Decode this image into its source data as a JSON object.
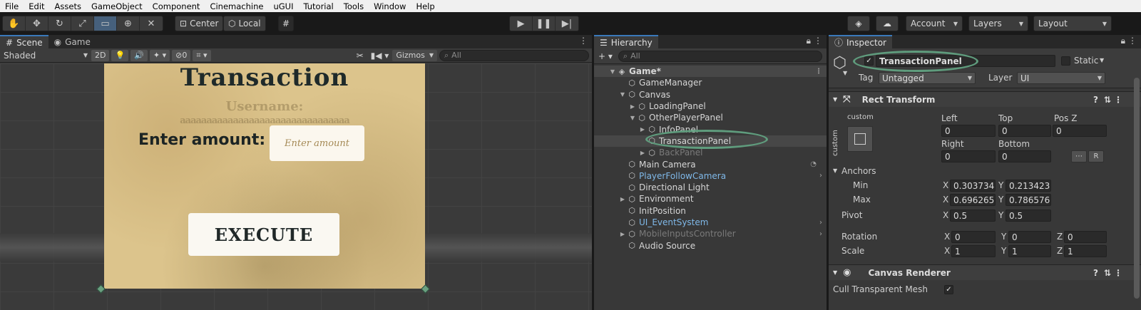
{
  "menu": [
    "File",
    "Edit",
    "Assets",
    "GameObject",
    "Component",
    "Cinemachine",
    "uGUI",
    "Tutorial",
    "Tools",
    "Window",
    "Help"
  ],
  "toolbar": {
    "pivot_mode": "Center",
    "space_mode": "Local",
    "account": "Account",
    "layers": "Layers",
    "layout": "Layout"
  },
  "scene_panel": {
    "tab_scene": "Scene",
    "tab_game": "Game",
    "shading": "Shaded",
    "mode_2d": "2D",
    "hidden_count": "0",
    "gizmos": "Gizmos",
    "search_placeholder": "All"
  },
  "game_view": {
    "title": "Transaction",
    "ghost_line1": "Username:",
    "ghost_line2": "aaaaaaaaaaaaaaaaaaaaaaaaaaaaaaaa",
    "amount_label": "Enter amount:",
    "amount_placeholder": "Enter amount",
    "execute_label": "EXECUTE"
  },
  "hierarchy": {
    "tab": "Hierarchy",
    "search_placeholder": "All",
    "nodes": [
      {
        "label": "Game*"
      },
      {
        "label": "GameManager"
      },
      {
        "label": "Canvas"
      },
      {
        "label": "LoadingPanel"
      },
      {
        "label": "OtherPlayerPanel"
      },
      {
        "label": "InfoPanel"
      },
      {
        "label": "TransactionPanel"
      },
      {
        "label": "BackPanel"
      },
      {
        "label": "Main Camera"
      },
      {
        "label": "PlayerFollowCamera"
      },
      {
        "label": "Directional Light"
      },
      {
        "label": "Environment"
      },
      {
        "label": "InitPosition"
      },
      {
        "label": "UI_EventSystem"
      },
      {
        "label": "MobileInputsController"
      },
      {
        "label": "Audio Source"
      }
    ]
  },
  "inspector": {
    "tab": "Inspector",
    "object_name": "TransactionPanel",
    "static_label": "Static",
    "tag_label": "Tag",
    "tag_value": "Untagged",
    "layer_label": "Layer",
    "layer_value": "UI",
    "rect_transform": {
      "title": "Rect Transform",
      "anchor_preset_top": "custom",
      "anchor_preset_side": "custom",
      "left_label": "Left",
      "left_value": "0",
      "top_label": "Top",
      "top_value": "0",
      "posz_label": "Pos Z",
      "posz_value": "0",
      "right_label": "Right",
      "right_value": "0",
      "bottom_label": "Bottom",
      "bottom_value": "0",
      "anchors_label": "Anchors",
      "min_label": "Min",
      "min_x": "0.303734",
      "min_y": "0.213423",
      "max_label": "Max",
      "max_x": "0.696265",
      "max_y": "0.786576",
      "pivot_label": "Pivot",
      "pivot_x": "0.5",
      "pivot_y": "0.5",
      "rotation_label": "Rotation",
      "rot_x": "0",
      "rot_y": "0",
      "rot_z": "0",
      "scale_label": "Scale",
      "scale_x": "1",
      "scale_y": "1",
      "scale_z": "1",
      "axis_x": "X",
      "axis_y": "Y",
      "axis_z": "Z",
      "raw_edit_btn": "R"
    },
    "canvas_renderer": {
      "title": "Canvas Renderer",
      "cull_label": "Cull Transparent Mesh",
      "cull_checked": "✓"
    }
  }
}
